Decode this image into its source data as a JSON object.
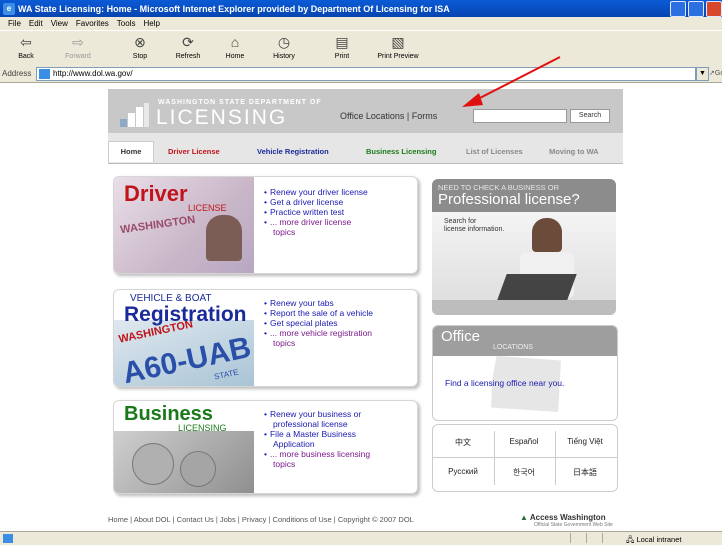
{
  "window": {
    "title": "WA State Licensing: Home - Microsoft Internet Explorer provided by Department Of Licensing for ISA"
  },
  "menu": [
    "File",
    "Edit",
    "View",
    "Favorites",
    "Tools",
    "Help"
  ],
  "toolbar": {
    "back": "Back",
    "forward": "Forward",
    "stop": "Stop",
    "refresh": "Refresh",
    "home": "Home",
    "history": "History",
    "print": "Print",
    "print_preview": "Print Preview"
  },
  "address": {
    "label": "Address",
    "url": "http://www.dol.wa.gov/",
    "go": "Go"
  },
  "header": {
    "dept_small": "WASHINGTON STATE DEPARTMENT OF",
    "dept_big": "LICENSING",
    "office_locations": "Office Locations",
    "separator": "|",
    "forms": "Forms",
    "search_value": "",
    "search_button": "Search"
  },
  "tabs": [
    {
      "label": "Home",
      "color": "#333333"
    },
    {
      "label": "Driver License",
      "color": "#c0141a"
    },
    {
      "label": "Vehicle Registration",
      "color": "#1a2a9a"
    },
    {
      "label": "Business Licensing",
      "color": "#1a7a1a"
    },
    {
      "label": "List of Licenses",
      "color": "#888888"
    },
    {
      "label": "Moving to WA",
      "color": "#888888"
    }
  ],
  "driver": {
    "title": "Driver",
    "subtitle": "LICENSE",
    "card_text": "WASHINGTON",
    "bullets": [
      "Renew your driver license",
      "Get a driver license",
      "Practice written test"
    ],
    "more": "... more driver license",
    "more2": "topics"
  },
  "vehicle": {
    "subtitle": "VEHICLE & BOAT",
    "title": "Registration",
    "plate_state": "WASHINGTON",
    "plate": "A60-UAB",
    "plate_bottom": "STATE",
    "bullets": [
      "Renew your tabs",
      "Report the sale of a vehicle",
      "Get special plates"
    ],
    "more": "... more vehicle registration",
    "more2": "topics"
  },
  "business": {
    "title": "Business",
    "subtitle": "LICENSING",
    "bullets": [
      "Renew your business or",
      "professional license",
      "File a Master Business",
      "Application"
    ],
    "more": "... more business licensing",
    "more2": "topics"
  },
  "promo": {
    "top": "NEED TO CHECK A BUSINESS OR",
    "headline": "Professional license?",
    "search1": "Search for",
    "search2": "license information."
  },
  "office": {
    "title": "Office",
    "subtitle": "LOCATIONS",
    "text": "Find a licensing office near you."
  },
  "languages": [
    "中文",
    "Español",
    "Tiếng Việt",
    "Русский",
    "한국어",
    "日本語"
  ],
  "footer": {
    "links": "Home | About DOL | Contact Us | Jobs | Privacy | Conditions of Use | Copyright © 2007 DOL",
    "access": "Access Washington",
    "access_sub": "Official State Government Web Site"
  },
  "status": {
    "zone": "Local intranet"
  },
  "colors": {
    "driver_red": "#c0141a",
    "registration_blue": "#1a2a9a",
    "business_green": "#1a7a1a",
    "arrow_red": "#e01010"
  }
}
